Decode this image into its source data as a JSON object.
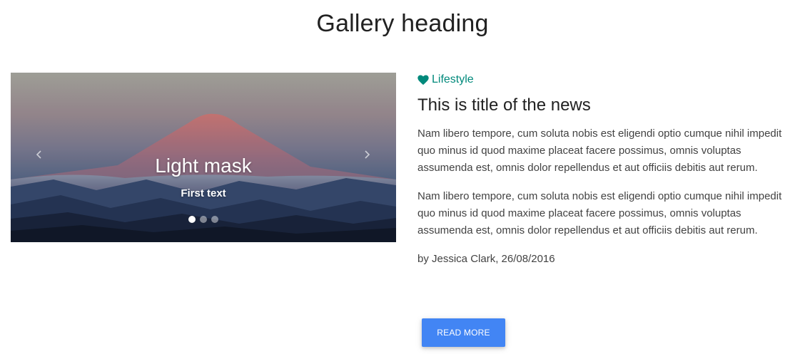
{
  "page": {
    "heading": "Gallery heading"
  },
  "carousel": {
    "slide_title": "Light mask",
    "slide_text": "First text",
    "prev_icon": "chevron-left-icon",
    "next_icon": "chevron-right-icon",
    "indicators": [
      {
        "active": true
      },
      {
        "active": false
      },
      {
        "active": false
      }
    ]
  },
  "article": {
    "category_icon": "heart-icon",
    "category": "Lifestyle",
    "category_color": "#00897b",
    "title": "This is title of the news",
    "paragraphs": [
      "Nam libero tempore, cum soluta nobis est eligendi optio cumque nihil impedit quo minus id quod maxime placeat facere possimus, omnis voluptas assumenda est, omnis dolor repellendus et aut officiis debitis aut rerum.",
      "Nam libero tempore, cum soluta nobis est eligendi optio cumque nihil impedit quo minus id quod maxime placeat facere possimus, omnis voluptas assumenda est, omnis dolor repellendus et aut officiis debitis aut rerum."
    ],
    "byline": "by Jessica Clark, 26/08/2016",
    "button_label": "READ MORE",
    "button_color": "#4285f4"
  }
}
